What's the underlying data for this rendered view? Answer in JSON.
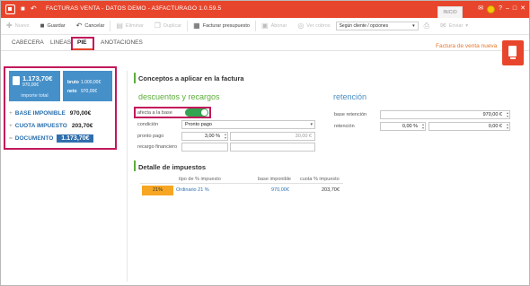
{
  "titlebar": {
    "title": "FACTURAS VENTA - DATOS DEMO - A3FACTURAGO 1.0.59.5",
    "inicio_tab": "INICIO",
    "help_label": "?"
  },
  "toolbar": {
    "nuevo": "Nuevo",
    "guardar": "Guardar",
    "cancelar": "Cancelar",
    "eliminar": "Eliminar",
    "duplicar": "Duplicar",
    "facturar_presupuesto": "Facturar presupuesto",
    "abonar": "Abonar",
    "ver_cobros": "Ver cobros",
    "select_value": "Según cliente / opciones",
    "enviar": "Enviar"
  },
  "tabs": {
    "cabecera": "CABECERA",
    "lineas": "LINEAS",
    "pie": "PIE",
    "anotaciones": "ANOTACIONES"
  },
  "header_right": {
    "new_invoice_title": "Factura de venta nueva"
  },
  "summary": {
    "total_big": "1.173,70€",
    "total_small": "970,00€",
    "total_label": "importe total",
    "bruto_label": "bruto",
    "bruto_value": "1.000,00€",
    "neto_label": "neto",
    "neto_value": "970,00€",
    "base_imponible_label": "BASE IMPONIBLE",
    "base_imponible_value": "970,00€",
    "cuota_impuesto_label": "CUOTA IMPUESTO",
    "cuota_impuesto_value": "203,70€",
    "documento_label": "DOCUMENTO",
    "documento_value": "1.173,70€"
  },
  "conceptos": {
    "title": "Conceptos a aplicar en la factura",
    "descuentos_title": "descuentos y recargos",
    "retencion_title": "retención",
    "afecta_label": "afecta a la base",
    "afecta_on": true,
    "condicion_label": "condición",
    "condicion_value": "Pronto pago",
    "pronto_pago_label": "pronto pago",
    "pronto_pago_pct": "3,00 %",
    "pronto_pago_amount": "30,00 €",
    "recargo_label": "recargo financiero",
    "recargo_pct": "",
    "recargo_amount": "",
    "base_retencion_label": "base retención",
    "base_retencion_value": "970,00 €",
    "retencion_label": "retención",
    "retencion_pct": "0,00 %",
    "retencion_amount": "0,00 €"
  },
  "impuestos": {
    "title": "Detalle de impuestos",
    "col_tipo": "tipo de % impuesto",
    "col_base": "base imponible",
    "col_cuota": "cuota % impuesto",
    "rows": [
      {
        "pct": "21%",
        "tipo": "Ordinario 21 %",
        "base": "970,00€",
        "cuota": "203,70€"
      }
    ]
  },
  "colors": {
    "brand": "#e8462c",
    "accent_green": "#5cae3a",
    "tile_blue": "#4690c9",
    "highlight": "#c2185b"
  }
}
